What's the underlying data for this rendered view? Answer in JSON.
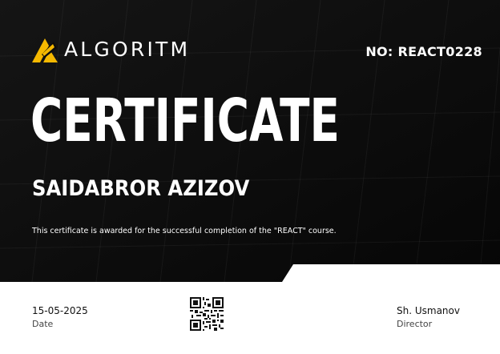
{
  "brand": {
    "name": "ALGORITM",
    "logo_icon": "algoritm-logo-icon"
  },
  "certificate": {
    "number": "NO: REACT0228",
    "title": "CERTIFICATE",
    "recipient": "SAIDABROR AZIZOV",
    "description": "This certificate is awarded for the successful completion of the \"REACT\" course."
  },
  "footer": {
    "date_value": "15-05-2025",
    "date_label": "Date",
    "signer_name": "Sh. Usmanov",
    "signer_role": "Director",
    "qr_icon": "qr-code-icon"
  },
  "colors": {
    "background_dark": "#0c0c0c",
    "accent": "#f5b800",
    "text_light": "#ffffff",
    "paper": "#ffffff"
  }
}
